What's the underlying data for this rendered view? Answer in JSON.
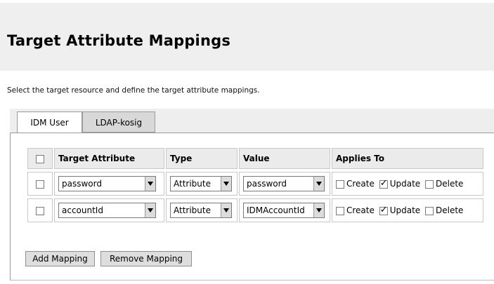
{
  "header": {
    "title": "Target Attribute Mappings"
  },
  "instructions": "Select the target resource and define the target attribute mappings.",
  "tabs": [
    {
      "label": "IDM User",
      "active": true
    },
    {
      "label": "LDAP-kosig",
      "active": false
    }
  ],
  "table": {
    "columns": [
      "Target Attribute",
      "Type",
      "Value",
      "Applies To"
    ],
    "rows": [
      {
        "selected": false,
        "target_attribute": "password",
        "type": "Attribute",
        "value": "password",
        "create": false,
        "update": true,
        "delete": false
      },
      {
        "selected": false,
        "target_attribute": "accountId",
        "type": "Attribute",
        "value": "IDMAccountId",
        "create": false,
        "update": true,
        "delete": false
      }
    ],
    "applies_labels": {
      "create": "Create",
      "update": "Update",
      "delete": "Delete"
    }
  },
  "buttons": {
    "add": "Add Mapping",
    "remove": "Remove Mapping"
  }
}
